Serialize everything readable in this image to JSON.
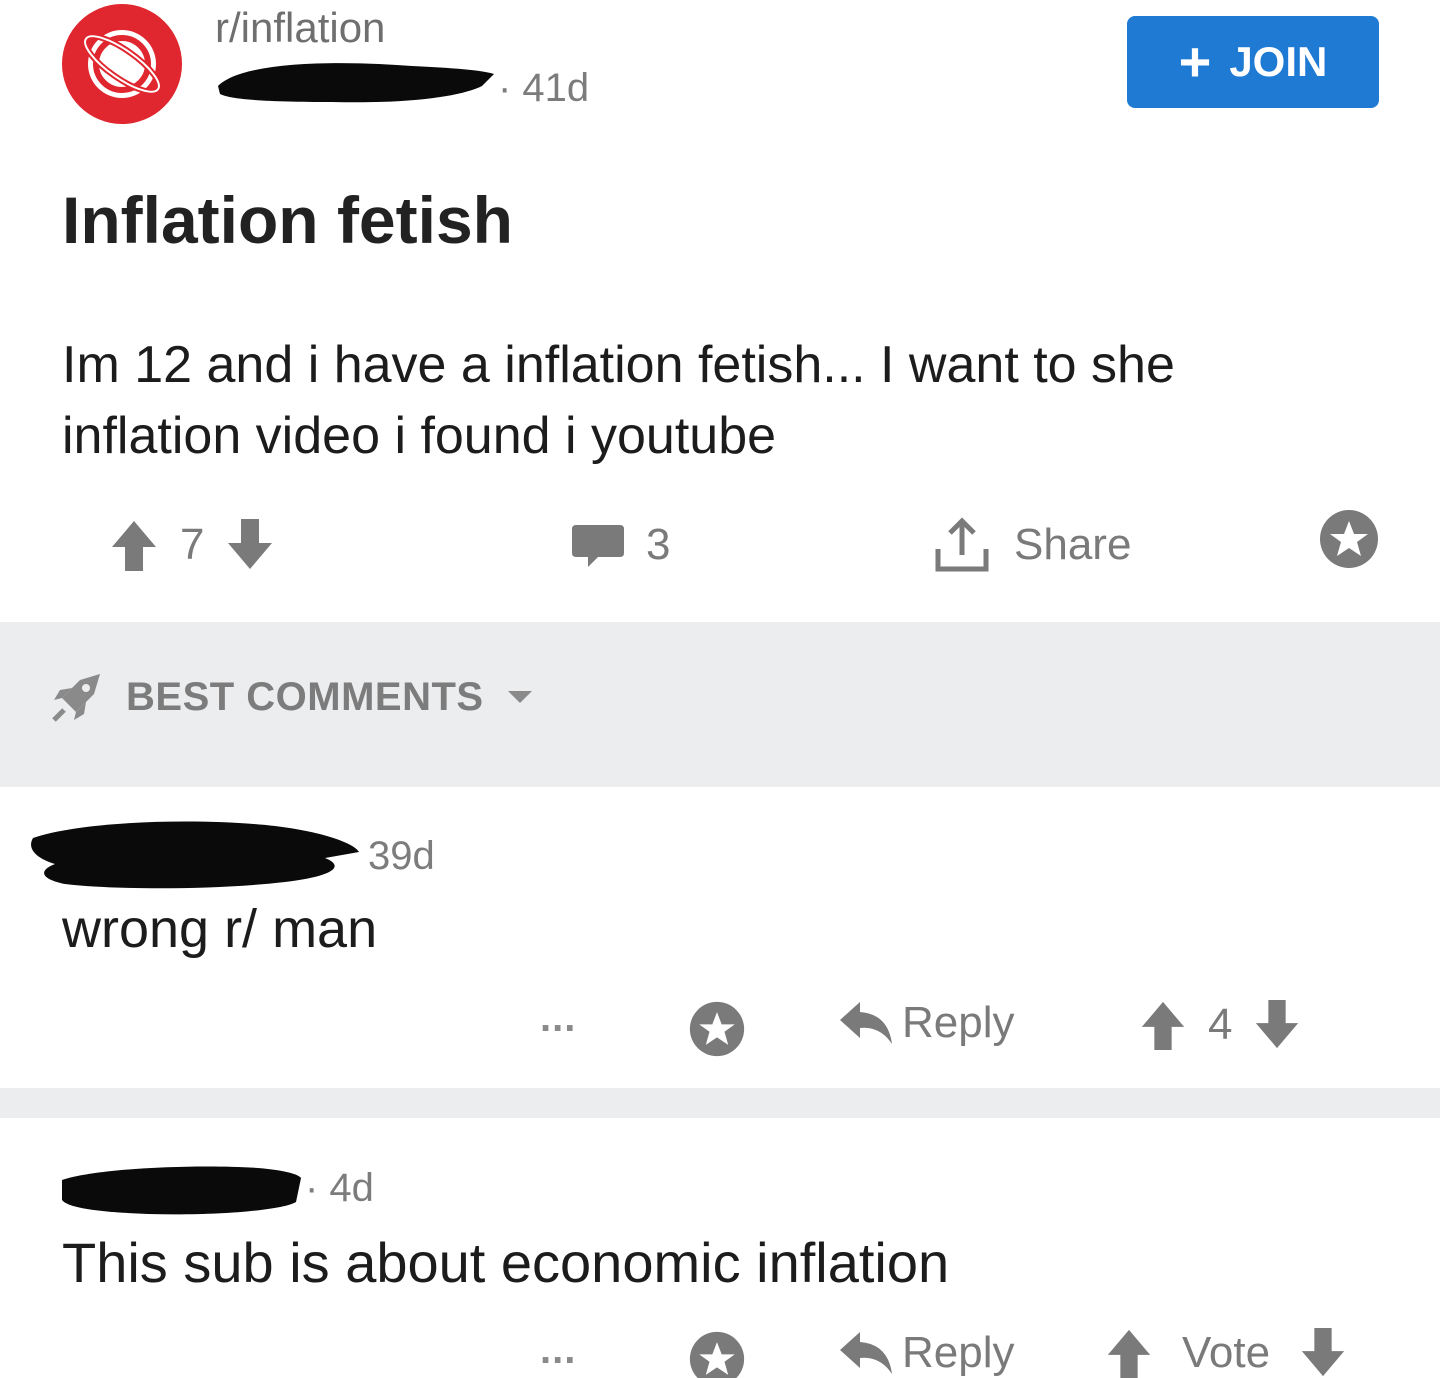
{
  "post": {
    "subreddit": "r/inflation",
    "age": "· 41d",
    "join_label": "JOIN",
    "title": "Inflation fetish",
    "body": "Im 12 and i have a inflation fetish... I want to she inflation video i found i youtube",
    "score": "7",
    "comment_count": "3",
    "share_label": "Share"
  },
  "sort": {
    "label": "BEST COMMENTS"
  },
  "comments": [
    {
      "age": "39d",
      "text": "wrong r/ man",
      "more": "...",
      "reply_label": "Reply",
      "score": "4"
    },
    {
      "age": "· 4d",
      "text": "This sub is about economic inflation",
      "more": "...",
      "reply_label": "Reply",
      "score": "Vote"
    }
  ],
  "colors": {
    "accent": "#1f7ad4",
    "subreddit_icon": "#e0262e",
    "muted_text": "#7c7c7c",
    "divider": "#ebedef"
  }
}
